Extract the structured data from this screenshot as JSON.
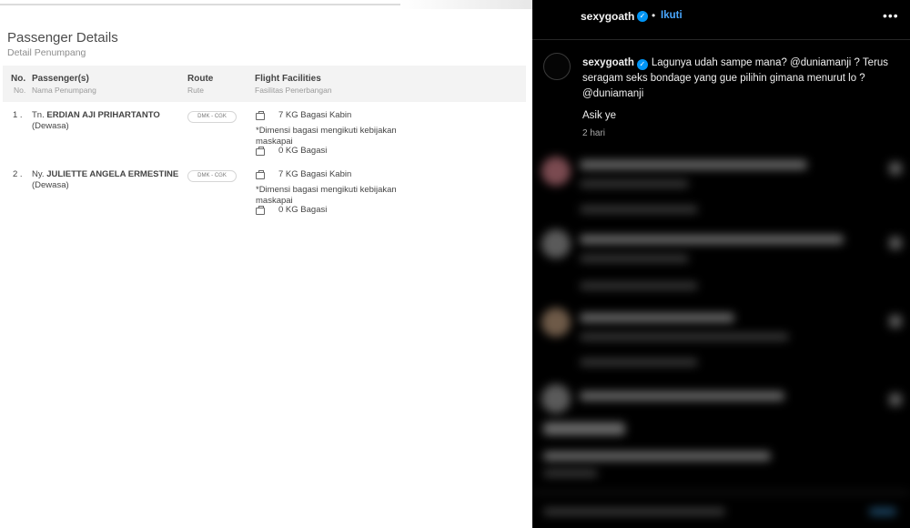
{
  "ticket": {
    "title": "Passenger Details",
    "subtitle": "Detail Penumpang",
    "columns": [
      {
        "label": "No.",
        "sub": "No."
      },
      {
        "label": "Passenger(s)",
        "sub": "Nama Penumpang"
      },
      {
        "label": "Route",
        "sub": "Rute"
      },
      {
        "label": "Flight Facilities",
        "sub": "Fasilitas Penerbangan"
      }
    ],
    "passengers": [
      {
        "no": "1 .",
        "title": "Tn.",
        "name": "ERDIAN AJI PRIHARTANTO",
        "type": "(Dewasa)",
        "route": "DMK - CGK",
        "cabin": "7 KG Bagasi Kabin",
        "note": "*Dimensi bagasi mengikuti kebijakan maskapai",
        "baggage": "0 KG Bagasi"
      },
      {
        "no": "2 .",
        "title": "Ny.",
        "name": "JULIETTE ANGELA ERMESTINE",
        "type": "(Dewasa)",
        "route": "DMK - CGK",
        "cabin": "7 KG Bagasi Kabin",
        "note": "*Dimensi bagasi mengikuti kebijakan maskapai",
        "baggage": "0 KG Bagasi"
      }
    ],
    "icons": {
      "luggage": "luggage-icon"
    }
  },
  "instagram": {
    "username": "sexygoath",
    "separator": "•",
    "follow_label": "Ikuti",
    "more_icon": "more-options-icon",
    "caption_line1": "Lagunya udah sampe mana? @duniamanji ? Terus seragam seks bondage yang gue pilihin gimana menurut lo ? @duniamanji",
    "caption_line2": "Asik ye",
    "time": "2 hari",
    "colors": {
      "background": "#000000",
      "link": "#0095f6",
      "text": "#f5f5f5"
    }
  }
}
